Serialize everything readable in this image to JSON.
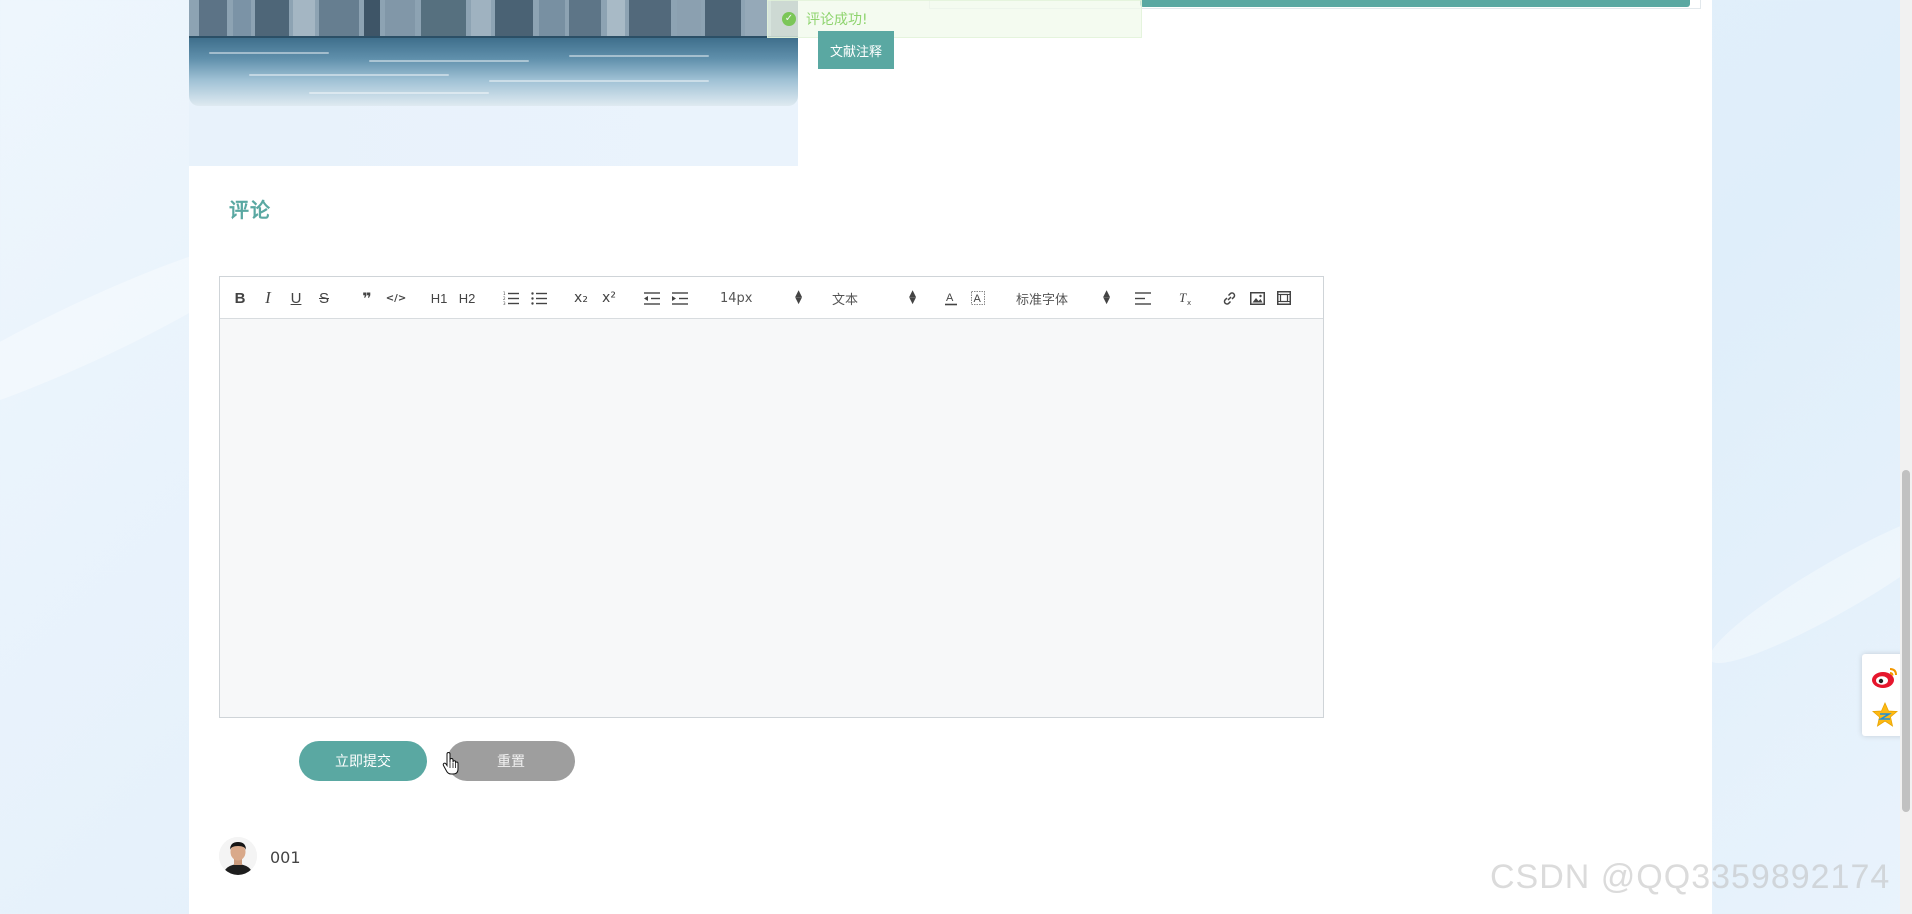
{
  "notification": {
    "message": "评论成功!"
  },
  "actions": {
    "note_button": "文献注释"
  },
  "comments": {
    "title": "评论",
    "submit_label": "立即提交",
    "reset_label": "重置"
  },
  "editor": {
    "font_size_value": "14px",
    "header_value": "文本",
    "font_family_value": "标准字体",
    "h1_label": "H1",
    "h2_label": "H2",
    "sub_label": "x₂",
    "sup_label": "x²",
    "bold_label": "B",
    "italic_label": "I",
    "underline_label": "U",
    "strike_label": "S",
    "quote_label": "❞",
    "code_label": "</>",
    "icons": [
      "bold-icon",
      "italic-icon",
      "underline-icon",
      "strike-icon",
      "quote-icon",
      "code-icon",
      "h1-icon",
      "h2-icon",
      "ordered-list-icon",
      "bullet-list-icon",
      "subscript-icon",
      "superscript-icon",
      "outdent-icon",
      "indent-icon",
      "font-color-icon",
      "background-color-icon",
      "align-icon",
      "clear-format-icon",
      "link-icon",
      "image-icon",
      "video-icon"
    ]
  },
  "comment_list": [
    {
      "username": "001"
    }
  ],
  "watermark": "CSDN @QQ3359892174",
  "colors": {
    "accent": "#5aa8a2",
    "reset": "#9e9e9e",
    "success": "#67c23a"
  }
}
